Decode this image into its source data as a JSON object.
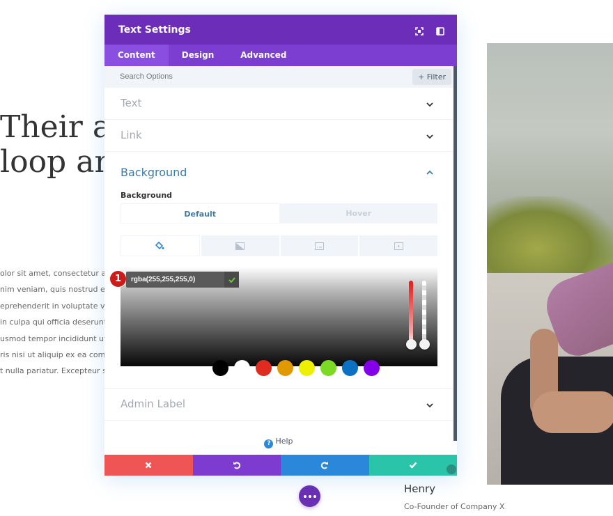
{
  "page": {
    "hero_lines": [
      "Their ab",
      "loop and"
    ],
    "body_lines": [
      "olor sit amet, consectetur adipi",
      "nim veniam, quis nostrud exer",
      "eprehenderit in voluptate velit",
      " in culpa qui officia deserunt m",
      "usmod tempor incididunt ut lal",
      "ris nisi ut aliquip ex ea commo",
      "t nulla pariatur. Excepteur sint"
    ],
    "person_name": "Henry",
    "person_role": "Co-Founder of Company X"
  },
  "modal": {
    "title": "Text Settings",
    "header_icons": [
      "fullscreen-icon",
      "split-view-icon"
    ],
    "tabs": [
      {
        "label": "Content",
        "active": true
      },
      {
        "label": "Design",
        "active": false
      },
      {
        "label": "Advanced",
        "active": false
      }
    ],
    "search": {
      "placeholder": "Search Options",
      "value": ""
    },
    "filter_label": "+ Filter",
    "sections": {
      "text": "Text",
      "link": "Link",
      "background": "Background",
      "admin_label": "Admin Label"
    },
    "background": {
      "field_label": "Background",
      "states": [
        {
          "label": "Default",
          "active": true
        },
        {
          "label": "Hover",
          "active": false
        }
      ],
      "type_tabs": [
        "color-fill-icon",
        "gradient-icon",
        "image-icon",
        "video-icon"
      ],
      "color_value": "rgba(255,255,255,0)",
      "annotation_number": "1",
      "swatches": [
        "#000000",
        "#ffffff",
        "#e02b20",
        "#e09900",
        "#edf000",
        "#7cda24",
        "#0c71c3",
        "#8300e9"
      ]
    },
    "help_label": "Help",
    "footer_buttons": [
      {
        "name": "discard",
        "color": "#ef5555"
      },
      {
        "name": "undo",
        "color": "#7e3bd0"
      },
      {
        "name": "redo",
        "color": "#2b87da"
      },
      {
        "name": "save",
        "color": "#29c4a9"
      }
    ]
  },
  "colors": {
    "header": "#6c2eb9",
    "tabs": "#7b3ed0",
    "accent_blue": "#3e7ca7"
  }
}
